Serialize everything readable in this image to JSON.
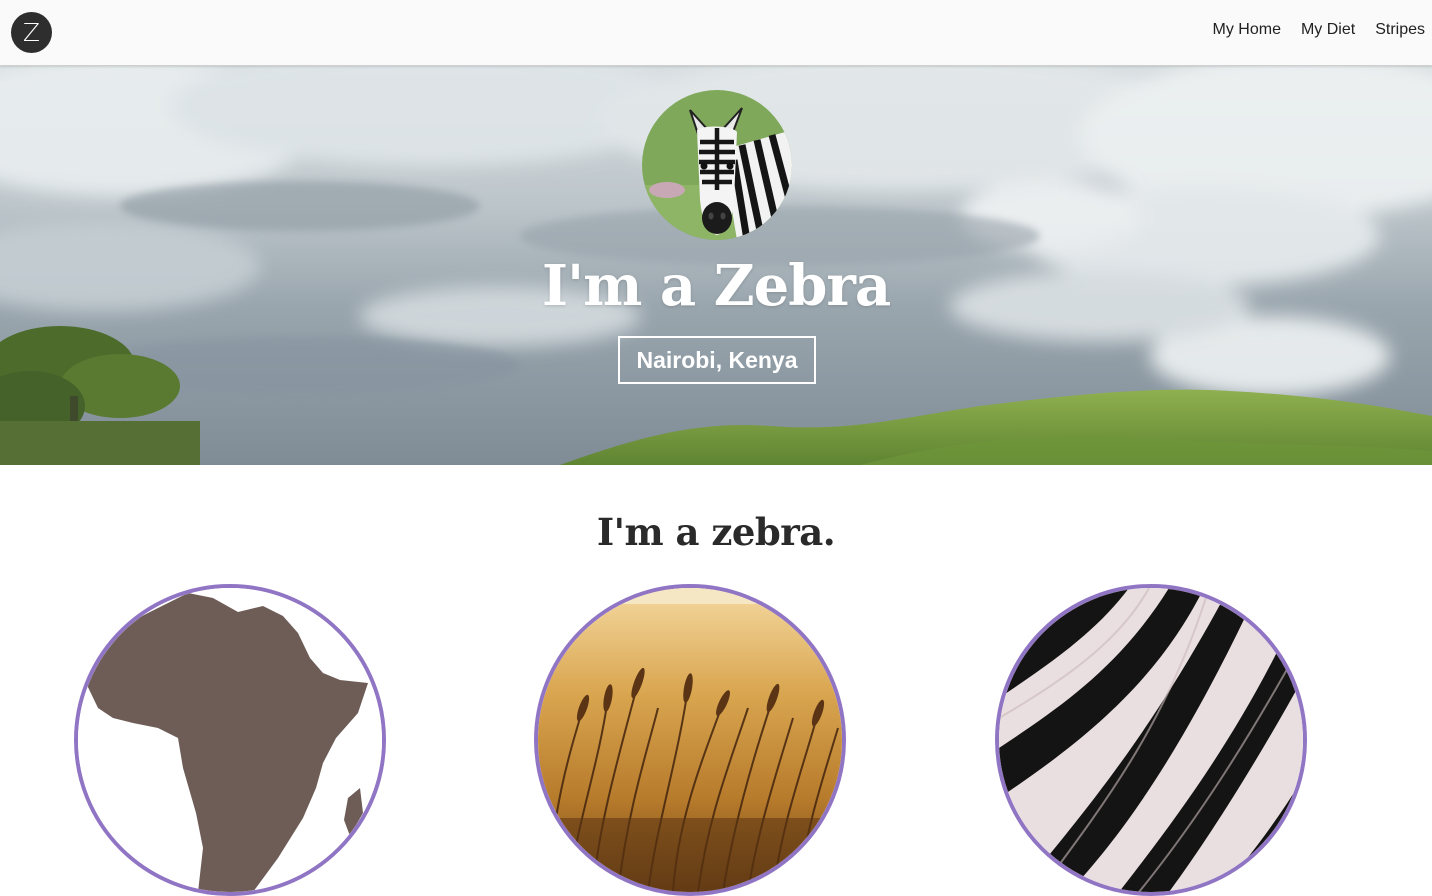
{
  "navbar": {
    "brand_letter": "Z",
    "links": [
      "My Home",
      "My Diet",
      "Stripes"
    ]
  },
  "hero": {
    "title": "I'm a Zebra",
    "location": "Nairobi, Kenya"
  },
  "section": {
    "heading": "I'm a zebra."
  },
  "icons": {
    "brand": "z-logo-icon"
  },
  "colors": {
    "circle_border": "#9175c5",
    "africa": "#6e5d57",
    "navbar_bg": "#fafafa"
  }
}
